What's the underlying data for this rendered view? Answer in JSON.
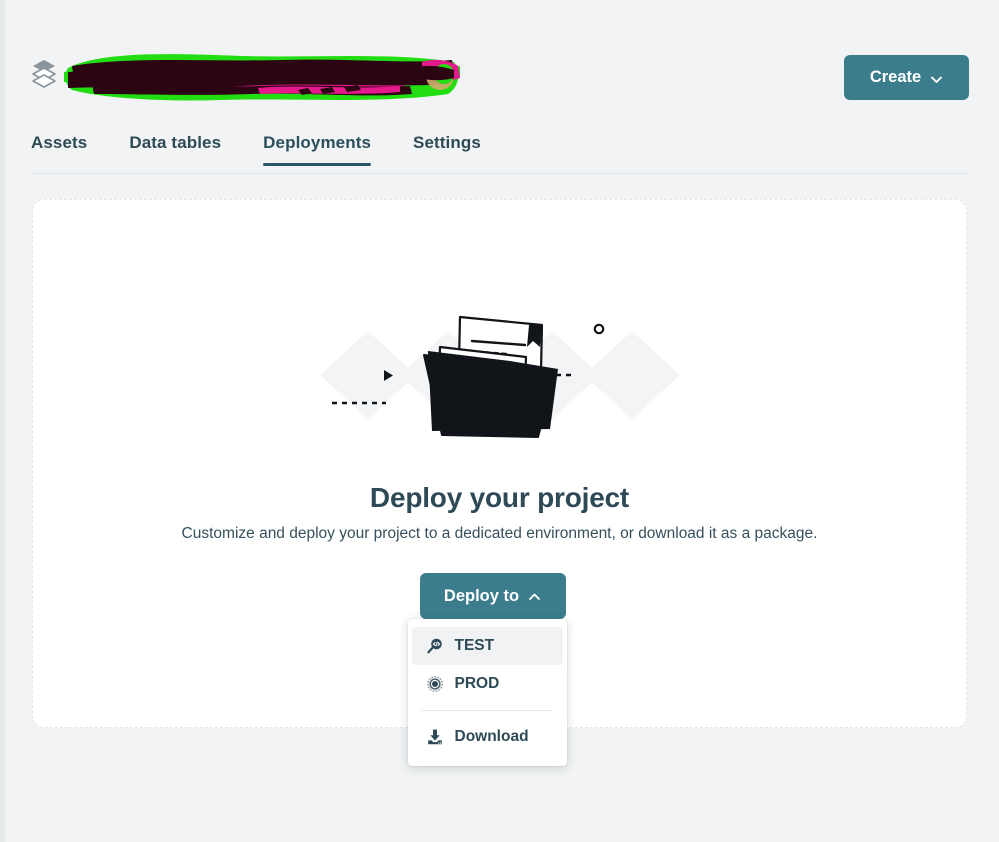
{
  "window": {
    "background_color": "#f1f3f4",
    "accent_color": "#3b7d8c",
    "text_color": "#2e4a57"
  },
  "header": {
    "logo_icon": "layers-stack-icon",
    "project_title": "",
    "project_title_redacted": true,
    "redaction_colors": {
      "highlight_green": "#22dd11",
      "scribble_dark": "#2b0512",
      "scribble_magenta": "#e6198c",
      "blob_tan": "#cdab6b"
    },
    "create_button": {
      "label": "Create",
      "icon": "chevron-down-icon"
    }
  },
  "tabs": [
    {
      "label": "Assets",
      "active": false
    },
    {
      "label": "Data tables",
      "active": false
    },
    {
      "label": "Deployments",
      "active": true
    },
    {
      "label": "Settings",
      "active": false
    }
  ],
  "empty_state": {
    "illustration": "open-folder-with-documents-illustration",
    "title": "Deploy your project",
    "subtitle": "Customize and deploy your project to a dedicated environment, or download it as a package."
  },
  "deploy": {
    "button_label": "Deploy to",
    "button_icon": "chevron-up-icon",
    "menu_open": true,
    "menu_items": [
      {
        "label": "TEST",
        "icon": "magnifier-code-icon",
        "hovered": true
      },
      {
        "label": "PROD",
        "icon": "gear-target-icon",
        "hovered": false
      },
      {
        "label": "Download",
        "icon": "download-icon",
        "hovered": false,
        "separator_before": true
      }
    ]
  }
}
